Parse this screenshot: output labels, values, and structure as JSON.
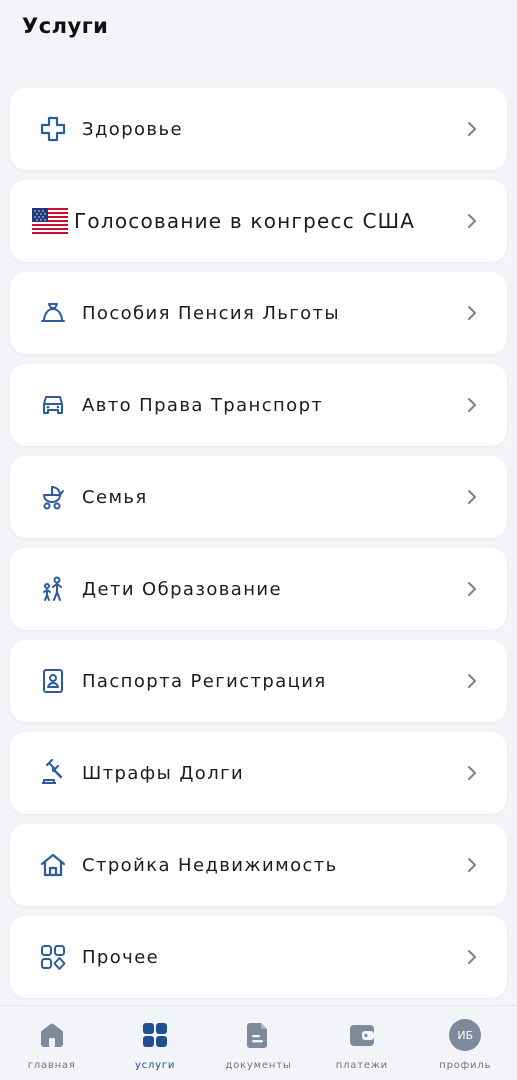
{
  "header": {
    "title": "Услуги"
  },
  "services": [
    {
      "label": "Здоровье",
      "icon": "medical-cross-icon"
    },
    {
      "label": "Голосование в конгресс США",
      "icon": "us-flag-icon"
    },
    {
      "label": "Пособия Пенсия Льготы",
      "icon": "wallet-bag-icon"
    },
    {
      "label": "Авто Права Транспорт",
      "icon": "car-icon"
    },
    {
      "label": "Семья",
      "icon": "baby-stroller-icon"
    },
    {
      "label": "Дети Образование",
      "icon": "parent-child-icon"
    },
    {
      "label": "Паспорта Регистрация",
      "icon": "id-card-icon"
    },
    {
      "label": "Штрафы Долги",
      "icon": "gavel-icon"
    },
    {
      "label": "Стройка Недвижимость",
      "icon": "house-icon"
    },
    {
      "label": "Прочее",
      "icon": "grid-shapes-icon"
    }
  ],
  "tabbar": {
    "items": [
      {
        "label": "главная",
        "icon": "home-icon"
      },
      {
        "label": "услуги",
        "icon": "services-grid-icon",
        "active": true
      },
      {
        "label": "документы",
        "icon": "document-icon"
      },
      {
        "label": "платежи",
        "icon": "wallet-icon"
      },
      {
        "label": "профиль",
        "icon": "avatar-icon",
        "avatar_text": "ИБ"
      }
    ]
  },
  "colors": {
    "accent": "#1f4f8f",
    "icon_inactive": "#7e8a9c",
    "background": "#f3f4f8",
    "card": "#ffffff"
  }
}
